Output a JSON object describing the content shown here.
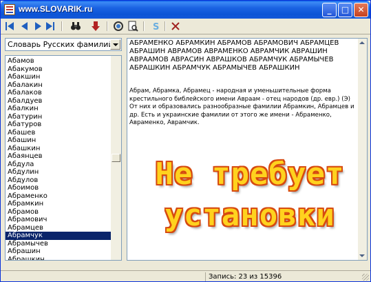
{
  "window": {
    "title": "www.SLOVARIK.ru"
  },
  "toolbar": {
    "icons": [
      "first-icon",
      "prev-icon",
      "next-icon",
      "last-icon",
      "binoculars-icon",
      "down-arrow-icon",
      "search-icon",
      "preview-icon",
      "dollar-icon",
      "close-icon"
    ]
  },
  "dictionary": {
    "selected": "Словарь Русских фамилий"
  },
  "list": {
    "items": [
      "Абамов",
      "Абакумов",
      "Абакшин",
      "Абалакин",
      "Абалаков",
      "Абалдуев",
      "Абалкин",
      "Абатурин",
      "Абатуров",
      "Абашев",
      "Абашин",
      "Абашкин",
      "Абаянцев",
      "Абдула",
      "Абдулин",
      "Абдулов",
      "Абоимов",
      "Абраменко",
      "Абрамкин",
      "Абрамов",
      "Абрамович",
      "Абрамцев",
      "Абрамчук",
      "Абрамычев",
      "Абрашин",
      "Абрашкин",
      "Абрикосов"
    ],
    "selected_index": 22
  },
  "entry": {
    "variants": "АБРАМЕНКО АБРАМКИН АБРАМОВ АБРАМОВИЧ АБРАМЦЕВ АБРАШИН АВРАМОВ АВРАМЕНКО АВРАМЧИК АВРАШИН АВРААМОВ АВРАСИН АВРАШКОВ АБРАМЧУК АБРАМЫЧЕВ АБРАШКИН АБРАМЧУК АБРАМЫЧЕВ АБРАШКИН",
    "description": "Абрам, Абрамка, Абрамец  - народная  и уменьшительные форма крестильного библейского имени  Авраам - отец народов (др. евр.) (Э)  От них и образовались разнообразные фамилии Абрамкин, Абрамцев и др. Есть и украинские фамилии от этого же имени  -  Абраменко,  Авраменко, Аврамчик."
  },
  "promo": {
    "line1": "Не требует",
    "line2": "установки"
  },
  "status": {
    "record": "Запись: 23 из 15396"
  },
  "colors": {
    "selection": "#0a246a",
    "promo_fill": "#ffd21e",
    "promo_outline": "#d64a10"
  }
}
